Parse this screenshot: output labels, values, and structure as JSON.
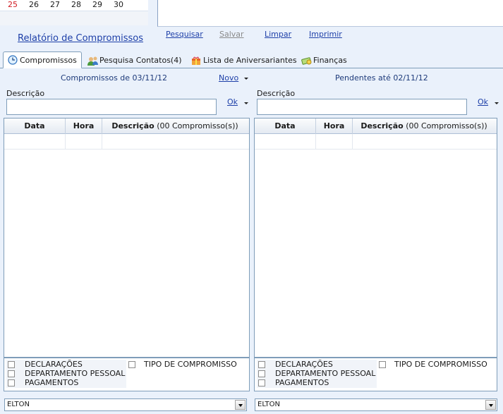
{
  "calendar": {
    "days": [
      "25",
      "26",
      "27",
      "28",
      "29",
      "30"
    ],
    "report_link": "Relatório de Compromissos"
  },
  "actions": {
    "search": "Pesquisar",
    "save": "Salvar",
    "clear": "Limpar",
    "print": "Imprimir"
  },
  "tabs": [
    {
      "label": "Compromissos",
      "icon": "clock-icon",
      "active": true
    },
    {
      "label": "Pesquisa Contatos(4)",
      "icon": "contacts-icon",
      "active": false
    },
    {
      "label": "Lista de Aniversariantes",
      "icon": "gift-icon",
      "active": false
    },
    {
      "label": "Finanças",
      "icon": "money-icon",
      "active": false
    }
  ],
  "left": {
    "title": "Compromissos de 03/11/12",
    "new_link": "Novo",
    "description_label": "Descrição",
    "ok_link": "Ok",
    "columns": {
      "date": "Data",
      "time": "Hora",
      "description": "Descrição",
      "count": "(00 Compromisso(s))"
    },
    "filters": [
      "DECLARAÇÕES",
      "DEPARTAMENTO PESSOAL",
      "PAGAMENTOS",
      "TIPO DE COMPROMISSO"
    ],
    "user": "ELTON"
  },
  "right": {
    "title": "Pendentes até 02/11/12",
    "description_label": "Descrição",
    "ok_link": "Ok",
    "columns": {
      "date": "Data",
      "time": "Hora",
      "description": "Descrição",
      "count": "(00 Compromisso(s))"
    },
    "filters": [
      "DECLARAÇÕES",
      "DEPARTAMENTO PESSOAL",
      "PAGAMENTOS",
      "TIPO DE COMPROMISSO"
    ],
    "user": "ELTON"
  }
}
